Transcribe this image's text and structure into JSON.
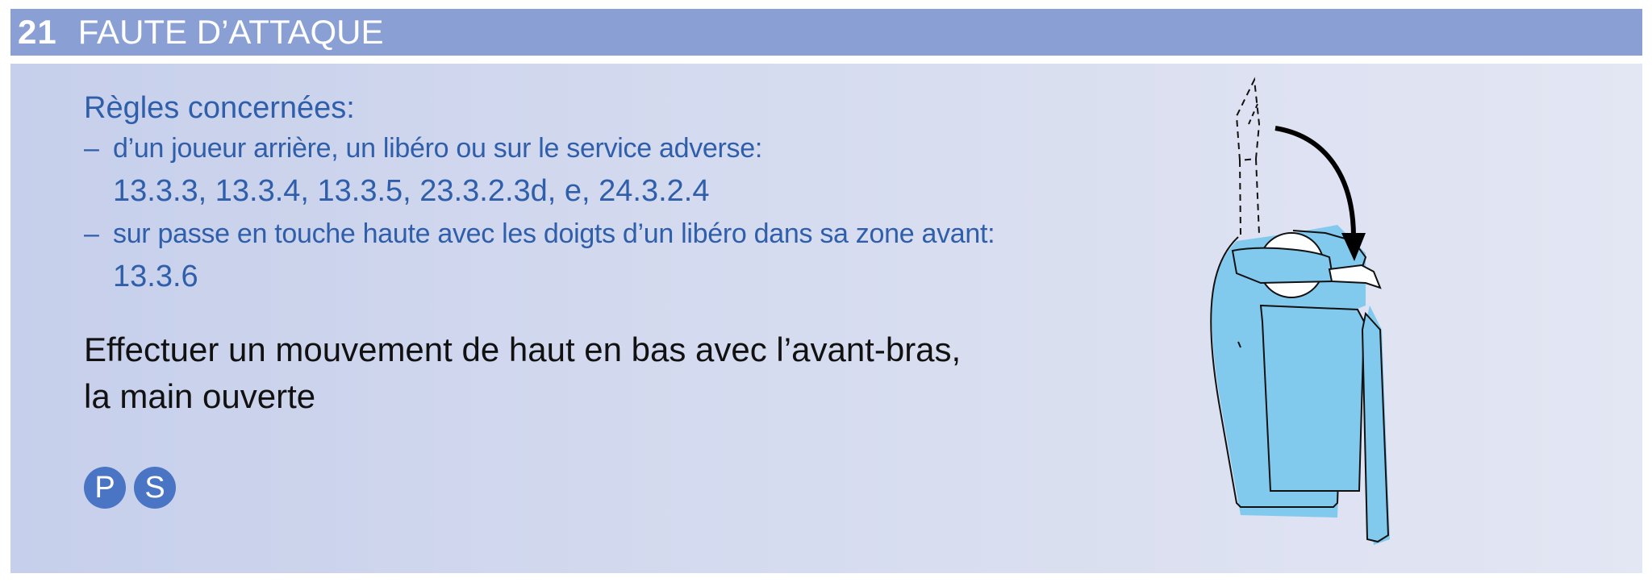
{
  "header": {
    "number": "21",
    "title": "FAUTE D’ATTAQUE"
  },
  "rules": {
    "heading": "Règles concernées:",
    "items": [
      {
        "dash": "–",
        "text": "d’un joueur arrière, un libéro ou sur le service adverse:",
        "numbers": "13.3.3, 13.3.4, 13.3.5, 23.3.2.3d, e, 24.3.2.4"
      },
      {
        "dash": "–",
        "text": "sur passe en touche haute avec les doigts d’un libéro dans sa zone avant:",
        "numbers": "13.3.6"
      }
    ]
  },
  "instruction": {
    "line1": "Effectuer un mouvement de haut en bas avec l’avant-bras,",
    "line2": "la main ouverte"
  },
  "badges": [
    "P",
    "S"
  ],
  "figure": {
    "icon": "referee-arm-downward-motion-icon"
  },
  "colors": {
    "header_bg": "#8a9fd3",
    "rule_text": "#2f5eaa",
    "badge_bg": "#4a74c4",
    "shirt": "#82c9ee"
  }
}
